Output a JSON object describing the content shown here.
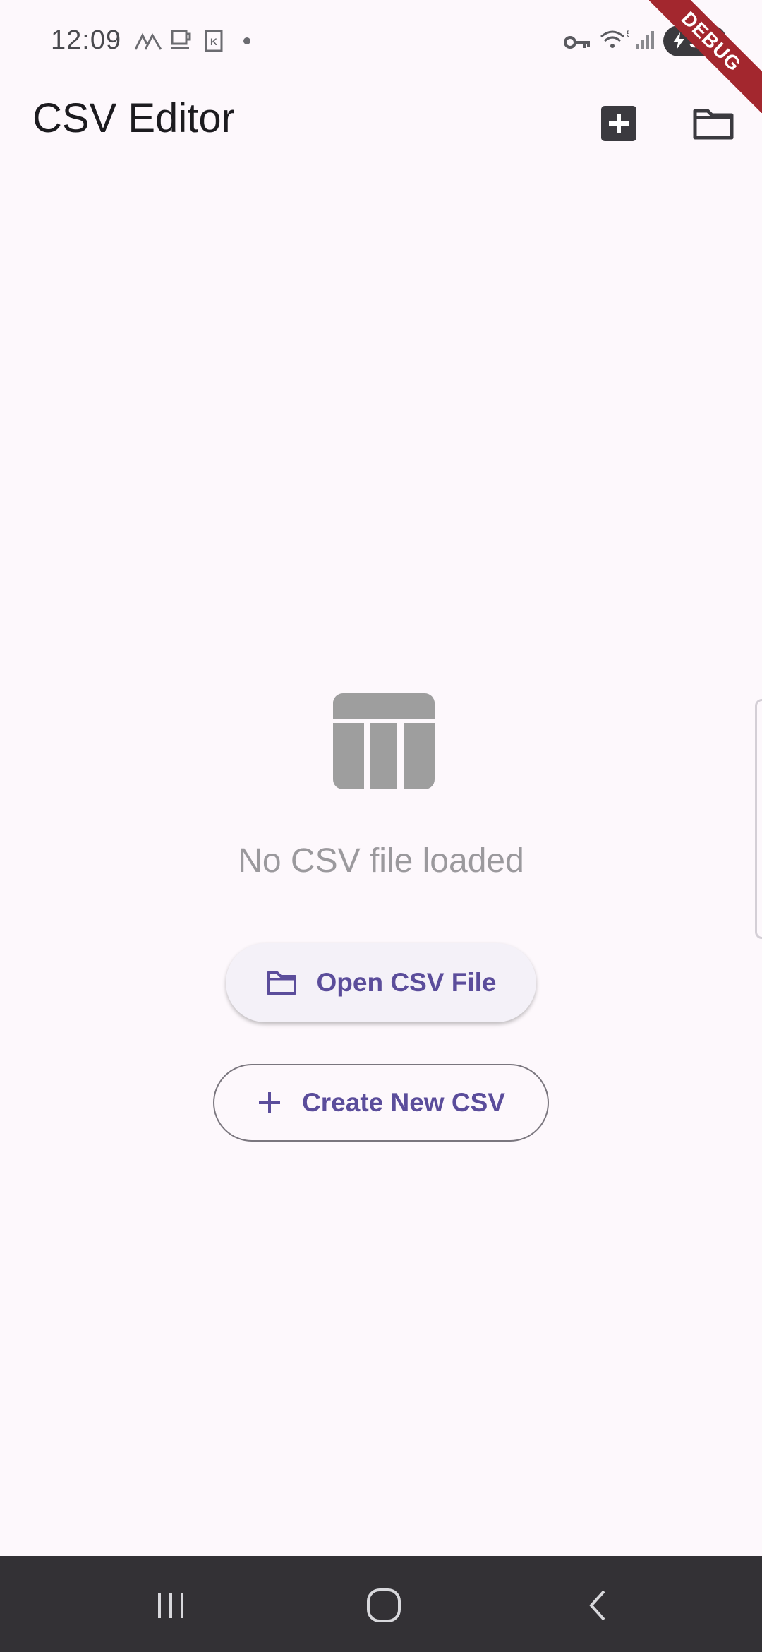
{
  "status_bar": {
    "time": "12:09",
    "battery": "91"
  },
  "app_bar": {
    "title": "CSV Editor",
    "actions": [
      {
        "icon": "add-box-icon"
      },
      {
        "icon": "folder-icon"
      }
    ]
  },
  "empty_state": {
    "icon": "table-icon",
    "message": "No CSV file loaded"
  },
  "buttons": {
    "open_label": "Open CSV File",
    "open_icon": "folder-icon",
    "new_label": "Create New CSV",
    "new_icon": "plus-icon"
  },
  "debug_banner": "DEBUG",
  "nav_bar": {
    "items": [
      {
        "icon": "recent-apps-icon"
      },
      {
        "icon": "home-icon"
      },
      {
        "icon": "back-icon"
      }
    ]
  },
  "colors": {
    "background": "#fdf8fc",
    "accent": "#5b4d9b",
    "muted_text": "#9b999d",
    "debug": "#a3272e"
  }
}
